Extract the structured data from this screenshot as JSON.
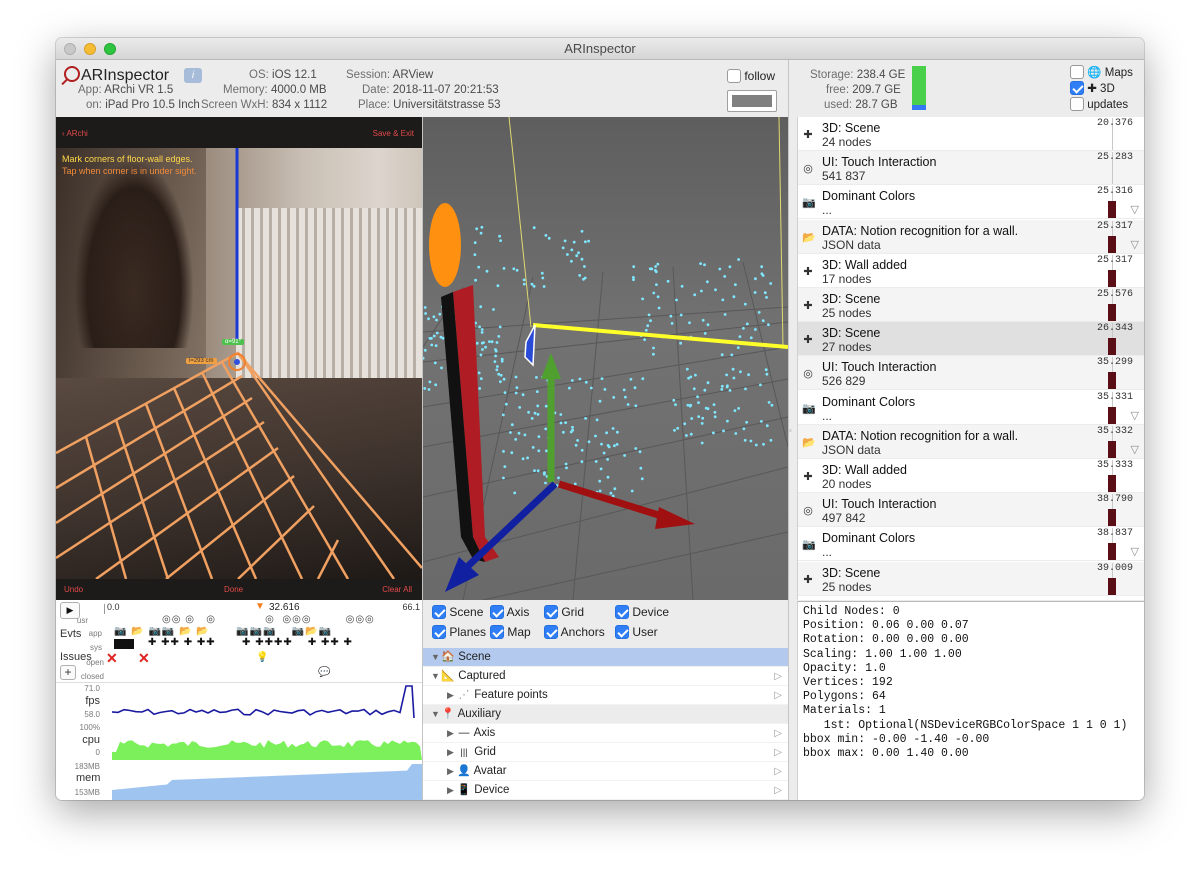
{
  "window": {
    "title": "ARInspector"
  },
  "header": {
    "app_name": "ARInspector",
    "info_icon": "i",
    "app_label": "App:",
    "app_value": "ARchi VR 1.5",
    "on_label": "on:",
    "on_value": "iPad Pro 10.5 Inch",
    "os_label": "OS:",
    "os_value": "iOS 12.1",
    "memory_label": "Memory:",
    "memory_value": "4000.0 MB",
    "screen_label": "Screen WxH:",
    "screen_value": "834 x 1112",
    "session_label": "Session:",
    "session_value": "ARView",
    "date_label": "Date:",
    "date_value": "2018-11-07 20:21:53",
    "place_label": "Place:",
    "place_value": "Universitätstrasse 53",
    "follow_label": "follow",
    "storage_label": "Storage:",
    "storage_value": "238.4 GE",
    "free_label": "free:",
    "free_value": "209.7 GE",
    "used_label": "used:",
    "used_value": "28.7 GB",
    "storage_used_fraction": 0.12,
    "maps_label": "Maps",
    "threed_label": "3D",
    "updates_label": "updates",
    "maps_checked": false,
    "threed_checked": true,
    "updates_checked": false,
    "follow_checked": false,
    "color_well": "#808080"
  },
  "phone": {
    "back_label": "ARchi",
    "save_label": "Save & Exit",
    "msg_line1": "Mark corners of floor-wall edges.",
    "msg_line2": "Tap when corner is in under sight.",
    "angle_badge": "α=91°",
    "distance_badge": "l=293 cm",
    "undo_label": "Undo",
    "done_label": "Done",
    "clear_label": "Clear All"
  },
  "timeline": {
    "start": "0.0",
    "marker": "32.616",
    "end": "66.1",
    "usr_label": "usr",
    "evts_label": "Evts",
    "app_label": "app",
    "sys_label": "sys",
    "issues_label": "Issues",
    "open_label": "open",
    "closed_label": "closed",
    "add_label": "+",
    "fps_label": "fps",
    "fps_max": "71.0",
    "fps_min": "58.0",
    "cpu_label": "cpu",
    "cpu_max": "100%",
    "cpu_min": "0",
    "mem_label": "mem",
    "mem_max": "183MB",
    "mem_min": "153MB"
  },
  "toggles": [
    {
      "label": "Scene",
      "checked": true
    },
    {
      "label": "Axis",
      "checked": true
    },
    {
      "label": "Grid",
      "checked": true
    },
    {
      "label": "Device",
      "checked": true
    },
    {
      "label": "Planes",
      "checked": true
    },
    {
      "label": "Map",
      "checked": true
    },
    {
      "label": "Anchors",
      "checked": true
    },
    {
      "label": "User",
      "checked": true
    }
  ],
  "tree": [
    {
      "label": "Scene",
      "icon": "house-icon",
      "glyph": "🏠"
    },
    {
      "label": "Captured",
      "icon": "ruler-icon",
      "glyph": "📐"
    },
    {
      "label": "Feature points",
      "icon": "dots-icon",
      "glyph": "⋰"
    },
    {
      "label": "Auxiliary",
      "icon": "pin-icon",
      "glyph": "📍"
    },
    {
      "label": "Axis",
      "icon": "line-icon",
      "glyph": "—"
    },
    {
      "label": "Grid",
      "icon": "grid-icon",
      "glyph": "|||"
    },
    {
      "label": "Avatar",
      "icon": "person-icon",
      "glyph": "👤"
    },
    {
      "label": "Device",
      "icon": "phone-icon",
      "glyph": "📱"
    }
  ],
  "events": [
    {
      "title": "3D: Scene",
      "sub": "24 nodes",
      "time": "20.376",
      "icon": "plus-icon",
      "glyph": "✚",
      "bar": false
    },
    {
      "title": "UI: Touch Interaction",
      "sub": "541 837",
      "time": "25.283",
      "icon": "touch-icon",
      "glyph": "◎",
      "bar": false
    },
    {
      "title": "Dominant Colors",
      "sub": "...",
      "time": "25.316",
      "icon": "camera-icon",
      "glyph": "📷",
      "bar": true,
      "tri": true
    },
    {
      "title": "DATA: Notion recognition for a wall.",
      "sub": "JSON data",
      "time": "25.317",
      "icon": "folder-icon",
      "glyph": "📂",
      "bar": true,
      "tri": true
    },
    {
      "title": "3D: Wall added",
      "sub": "17 nodes",
      "time": "25.317",
      "icon": "plus-icon",
      "glyph": "✚",
      "bar": true
    },
    {
      "title": "3D: Scene",
      "sub": "25 nodes",
      "time": "25.576",
      "icon": "plus-icon",
      "glyph": "✚",
      "bar": true
    },
    {
      "title": "3D: Scene",
      "sub": "27 nodes",
      "time": "26.343",
      "icon": "plus-icon",
      "glyph": "✚",
      "bar": true,
      "selected": true
    },
    {
      "title": "UI: Touch Interaction",
      "sub": "526 829",
      "time": "35.299",
      "icon": "touch-icon",
      "glyph": "◎",
      "bar": true
    },
    {
      "title": "Dominant Colors",
      "sub": "...",
      "time": "35.331",
      "icon": "camera-icon",
      "glyph": "📷",
      "bar": true,
      "tri": true
    },
    {
      "title": "DATA: Notion recognition for a wall.",
      "sub": "JSON data",
      "time": "35.332",
      "icon": "folder-icon",
      "glyph": "📂",
      "bar": true,
      "tri": true
    },
    {
      "title": "3D: Wall added",
      "sub": "20 nodes",
      "time": "35.333",
      "icon": "plus-icon",
      "glyph": "✚",
      "bar": true
    },
    {
      "title": "UI: Touch Interaction",
      "sub": "497 842",
      "time": "38.790",
      "icon": "touch-icon",
      "glyph": "◎",
      "bar": true
    },
    {
      "title": "Dominant Colors",
      "sub": "...",
      "time": "38.837",
      "icon": "camera-icon",
      "glyph": "📷",
      "bar": true,
      "tri": true
    },
    {
      "title": "3D: Scene",
      "sub": "25 nodes",
      "time": "39.009",
      "icon": "plus-icon",
      "glyph": "✚",
      "bar": true
    }
  ],
  "details": [
    "Child Nodes: 0",
    "Position: 0.06 0.00 0.07",
    "Rotation: 0.00 0.00 0.00",
    "Scaling: 1.00 1.00 1.00",
    "Opacity: 1.0",
    "Vertices: 192",
    "Polygons: 64",
    "Materials: 1",
    "   1st: Optional(NSDeviceRGBColorSpace 1 1 0 1)",
    "bbox min: -0.00 -1.40 -0.00",
    "bbox max: 0.00 1.40 0.00"
  ],
  "colors": {
    "accent": "#2f7ef5",
    "event_bar": "#5a0e16",
    "fps_line": "#1a1aa0",
    "cpu_fill": "#7cf05a",
    "mem_fill": "#9ec4ef",
    "selection": "#b3c9ed"
  }
}
